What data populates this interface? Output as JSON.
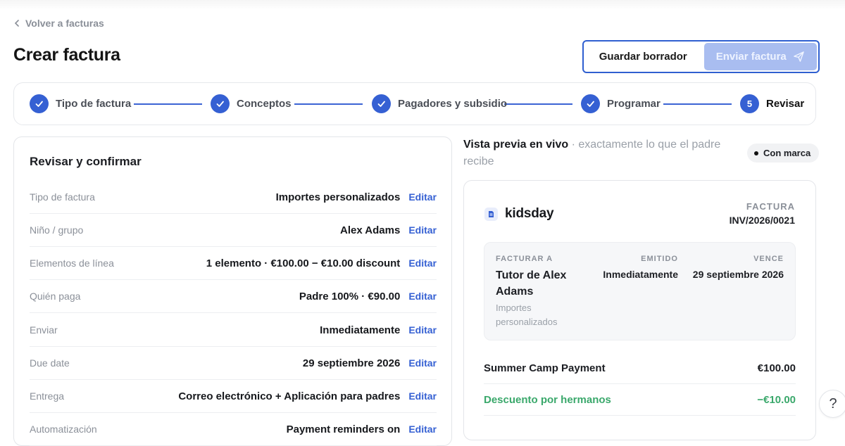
{
  "nav": {
    "back_label": "Volver a facturas"
  },
  "page": {
    "title": "Crear factura"
  },
  "actions": {
    "save_draft": "Guardar borrador",
    "send": "Enviar factura"
  },
  "steps": [
    {
      "label": "Tipo de factura",
      "state": "done"
    },
    {
      "label": "Conceptos",
      "state": "done"
    },
    {
      "label": "Pagadores y subsidio",
      "state": "done"
    },
    {
      "label": "Programar",
      "state": "done"
    },
    {
      "label": "Revisar",
      "state": "current",
      "number": "5"
    }
  ],
  "review": {
    "title": "Revisar y confirmar",
    "edit_label": "Editar",
    "rows": [
      {
        "label": "Tipo de factura",
        "value": "Importes personalizados"
      },
      {
        "label": "Niño / grupo",
        "value": "Alex Adams"
      },
      {
        "label": "Elementos de línea",
        "value": "1 elemento · €100.00 − €10.00 discount"
      },
      {
        "label": "Quién paga",
        "value": "Padre 100% · €90.00"
      },
      {
        "label": "Enviar",
        "value": "Inmediatamente"
      },
      {
        "label": "Due date",
        "value": "29 septiembre 2026"
      },
      {
        "label": "Entrega",
        "value": "Correo electrónico + Aplicación para padres"
      },
      {
        "label": "Automatización",
        "value": "Payment reminders on"
      }
    ]
  },
  "preview": {
    "heading": "Vista previa en vivo",
    "subheading": "· exactamente lo que el padre recibe",
    "brand_chip": "Con marca"
  },
  "invoice": {
    "brand": "kidsday",
    "kicker": "FACTURA",
    "number": "INV/2026/0021",
    "bill_to_label": "FACTURAR A",
    "bill_to_name": "Tutor de Alex Adams",
    "bill_to_sub": "Importes personalizados",
    "issued_label": "EMITIDO",
    "issued_value": "Inmediatamente",
    "due_label": "VENCE",
    "due_value": "29 septiembre 2026",
    "lines": [
      {
        "label": "Summer Camp Payment",
        "amount": "€100.00"
      },
      {
        "label": "Descuento por hermanos",
        "amount": "−€10.00"
      }
    ]
  },
  "help": {
    "icon": "?"
  },
  "colors": {
    "accent": "#3560d3",
    "discount": "#3aa86b",
    "send_disabled": "#a9bdf0"
  }
}
